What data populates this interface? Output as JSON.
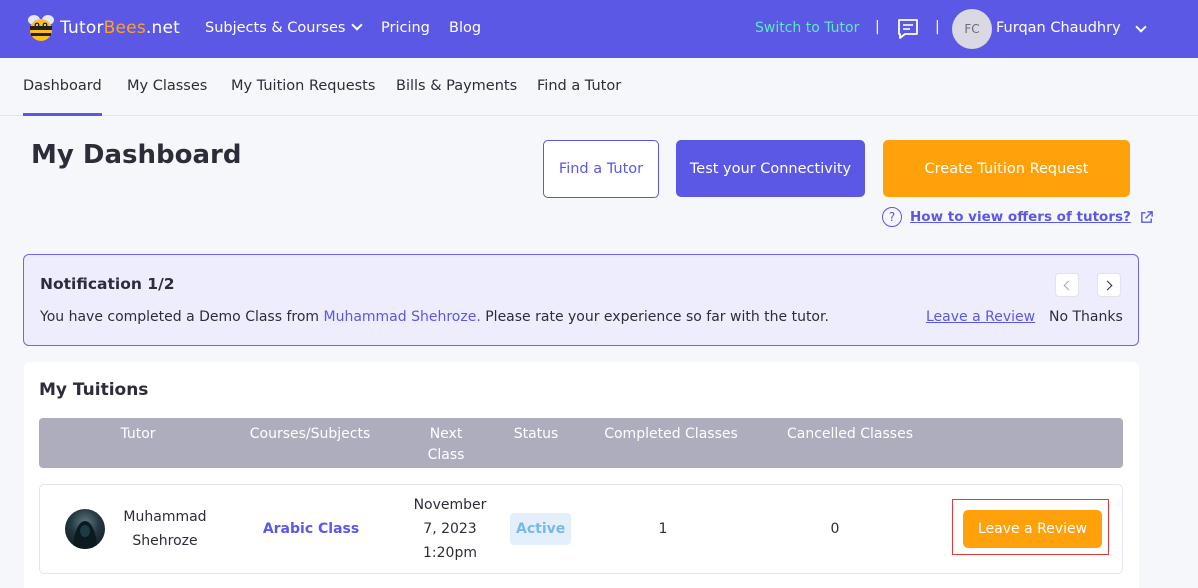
{
  "header": {
    "logo_prefix": "Tutor",
    "logo_accent": "Bees",
    "logo_suffix": ".net",
    "nav": [
      {
        "label": "Subjects & Courses",
        "has_dropdown": true
      },
      {
        "label": "Pricing"
      },
      {
        "label": "Blog"
      }
    ],
    "switch_label": "Switch to Tutor",
    "separator": "|",
    "chat_icon": "chat-icon",
    "user_initials": "FC",
    "user_name": "Furqan Chaudhry"
  },
  "tabs": [
    {
      "label": "Dashboard",
      "active": true
    },
    {
      "label": "My Classes"
    },
    {
      "label": "My Tuition Requests"
    },
    {
      "label": "Bills & Payments"
    },
    {
      "label": "Find a Tutor"
    }
  ],
  "page": {
    "title": "My Dashboard",
    "find_tutor_btn": "Find a Tutor",
    "connectivity_btn": "Test your Connectivity",
    "create_request_btn": "Create Tuition Request",
    "help_icon": "?",
    "help_link": "How to view offers of tutors?"
  },
  "notification": {
    "title": "Notification 1/2",
    "text_before": "You have completed a Demo Class from ",
    "tutor_name": "Muhammad Shehroze.",
    "text_after": " Please rate your experience so far with the tutor.",
    "review_link": "Leave a Review",
    "dismiss": "No Thanks"
  },
  "tuitions": {
    "title": "My Tuitions",
    "columns": [
      "Tutor",
      "Courses/Subjects",
      "Next Class",
      "Status",
      "Completed Classes",
      "Cancelled Classes"
    ],
    "column_next_line1": "Next",
    "column_next_line2": "Class",
    "rows": [
      {
        "tutor_line1": "Muhammad",
        "tutor_line2": "Shehroze",
        "course": "Arabic Class",
        "next_line1": "November",
        "next_line2": "7, 2023",
        "next_line3": "1:20pm",
        "status": "Active",
        "completed": "1",
        "cancelled": "0",
        "action": "Leave a Review"
      }
    ]
  },
  "colors": {
    "primary": "#5b58e6",
    "accent": "#ffa10a",
    "switch": "#5ee8c4",
    "highlight": "#e03a3a"
  }
}
